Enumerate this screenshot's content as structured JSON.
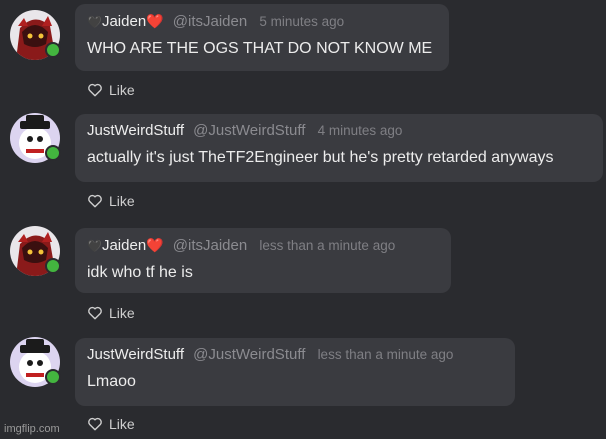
{
  "messages": [
    {
      "name_prefix": "🖤",
      "name": "Jaiden",
      "name_suffix": "❤️",
      "handle": "@itsJaiden",
      "time": "5 minutes ago",
      "text": "WHO ARE THE OGS THAT DO NOT KNOW ME",
      "like_label": "Like",
      "avatar": "jaiden-avatar"
    },
    {
      "name_prefix": "",
      "name": "JustWeirdStuff",
      "name_suffix": "",
      "handle": "@JustWeirdStuff",
      "time": "4 minutes ago",
      "text": "actually it's just TheTF2Engineer but he's pretty retarded anyways",
      "like_label": "Like",
      "avatar": "weird-avatar"
    },
    {
      "name_prefix": "🖤",
      "name": "Jaiden",
      "name_suffix": "❤️",
      "handle": "@itsJaiden",
      "time": "less than a minute ago",
      "text": "idk who tf he is",
      "like_label": "Like",
      "avatar": "jaiden-avatar"
    },
    {
      "name_prefix": "",
      "name": "JustWeirdStuff",
      "name_suffix": "",
      "handle": "@JustWeirdStuff",
      "time": "less than a minute ago",
      "text": "Lmaoo",
      "like_label": "Like",
      "avatar": "weird-avatar"
    }
  ],
  "watermark": "imgflip.com",
  "colors": {
    "background": "#2a2b2f",
    "bubble": "#3a3b40",
    "online": "#43b53f",
    "heart": "#e0312f"
  }
}
